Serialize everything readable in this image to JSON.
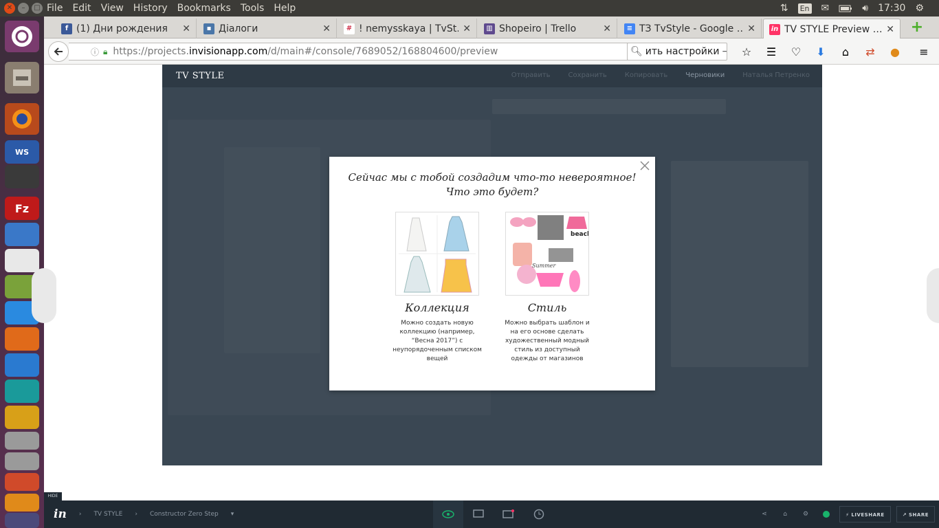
{
  "menubar": {
    "items": [
      "File",
      "Edit",
      "View",
      "History",
      "Bookmarks",
      "Tools",
      "Help"
    ],
    "lang": "En",
    "clock": "17:30"
  },
  "tabs": [
    {
      "label": "(1) Дни рождения",
      "icon": "facebook-icon",
      "color": "#3b5998"
    },
    {
      "label": "Діалоги",
      "icon": "vk-icon",
      "color": "#4a76a8"
    },
    {
      "label": "! nemysskaya | TvSt…",
      "icon": "slack-icon",
      "color": "#d0304a"
    },
    {
      "label": "Shopeiro | Trello",
      "icon": "trello-icon",
      "color": "#5f4a8e"
    },
    {
      "label": "ТЗ TvStyle - Google …",
      "icon": "google-docs-icon",
      "color": "#4285f4"
    },
    {
      "label": "TV STYLE Preview …",
      "icon": "invision-icon",
      "color": "#ff3366"
    }
  ],
  "urlbar": {
    "prefix": "https://projects.",
    "domain": "invisionapp.com",
    "path": "/d/main#/console/7689052/168804600/preview"
  },
  "search": {
    "value": "ить настройки"
  },
  "prototype": {
    "logo": "TV STYLE",
    "nav": [
      "Отправить",
      "Сохранить",
      "Копировать",
      "Черновики",
      "Наталья Петренко"
    ]
  },
  "modal": {
    "title_line1": "Сейчас мы с тобой создадим что-то невероятное!",
    "title_line2": "Что это будет?",
    "cards": [
      {
        "title": "Коллекция",
        "desc": "Можно создать новую коллекцию (например, “Весна 2017”) с неупорядоченным списком вещей"
      },
      {
        "title": "Стиль",
        "desc": "Можно выбрать шаблон и на его основе сделать художественный модный стиль из доступный одежды от магазинов",
        "img_text_beach": "beach",
        "img_text_summer": "Summer"
      }
    ]
  },
  "invision_bar": {
    "hide": "HIDE",
    "project": "TV STYLE",
    "screen": "Constructor Zero Step",
    "liveshare": "LIVESHARE",
    "share": "SHARE",
    "status_color": "#19b36b"
  },
  "colors": {
    "accent": "#ff3366",
    "proto_bg": "#3a4753",
    "bar_bg": "#202a33"
  }
}
